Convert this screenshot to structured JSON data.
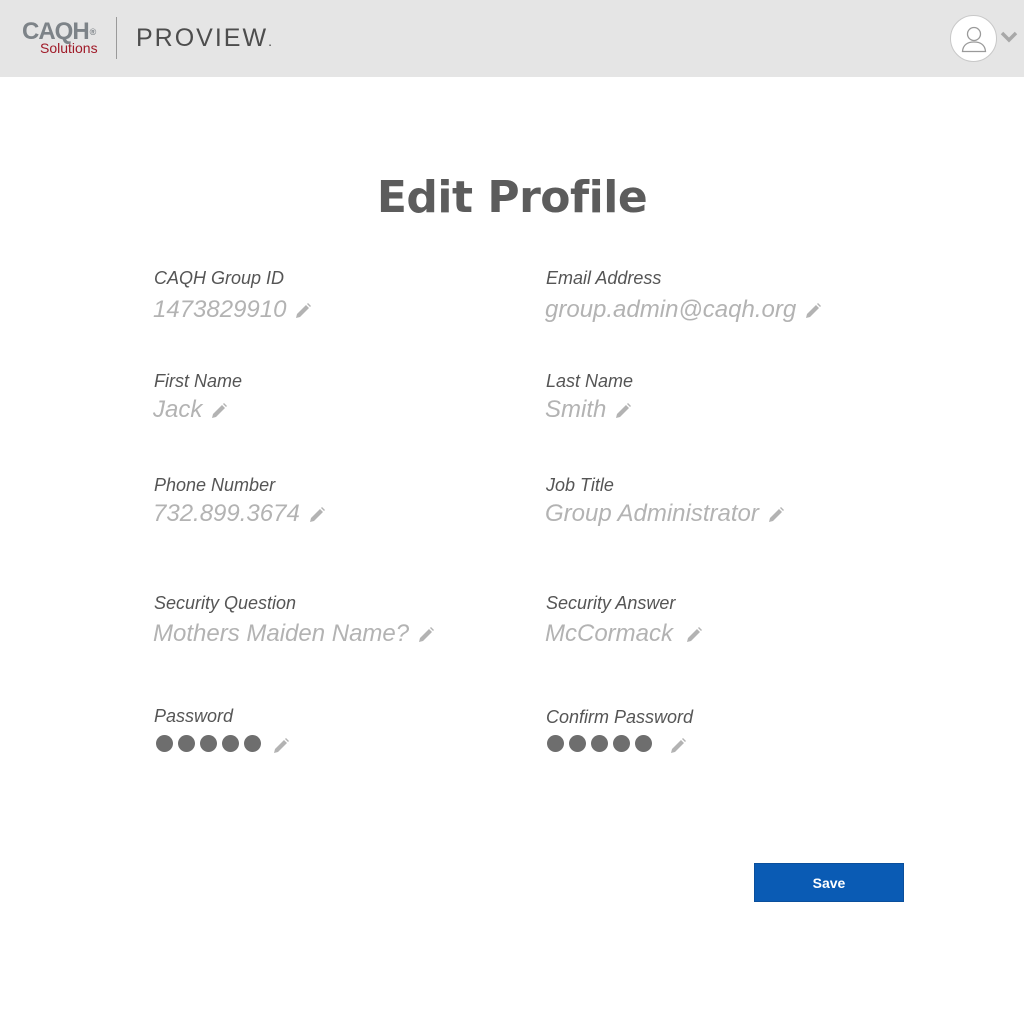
{
  "header": {
    "logo_caqh": "CAQH",
    "logo_caqh_mark": "®",
    "logo_solutions": "Solutions",
    "logo_product": "PROVIEW",
    "logo_product_mark": ".",
    "avatar_icon": "user-avatar-icon",
    "menu_icon": "chevron-down-icon"
  },
  "page": {
    "title": "Edit Profile"
  },
  "fields": {
    "group_id": {
      "label": "CAQH Group ID",
      "value": "1473829910"
    },
    "email": {
      "label": "Email Address",
      "value": "group.admin@caqh.org"
    },
    "first_name": {
      "label": "First Name",
      "value": "Jack"
    },
    "last_name": {
      "label": "Last Name",
      "value": "Smith"
    },
    "phone": {
      "label": "Phone Number",
      "value": "732.899.3674"
    },
    "job_title": {
      "label": "Job Title",
      "value": "Group Administrator"
    },
    "security_question": {
      "label": "Security Question",
      "value": "Mothers Maiden Name?"
    },
    "security_answer": {
      "label": "Security Answer",
      "value": "McCormack"
    },
    "password": {
      "label": "Password",
      "masked_length": 5
    },
    "confirm_password": {
      "label": "Confirm Password",
      "masked_length": 5
    }
  },
  "actions": {
    "save_label": "Save"
  },
  "colors": {
    "topbar": "#e5e5e5",
    "brand_red": "#a01a28",
    "primary_button": "#0a5bb4",
    "label_text": "#555555",
    "value_text": "#b3b3b3"
  }
}
